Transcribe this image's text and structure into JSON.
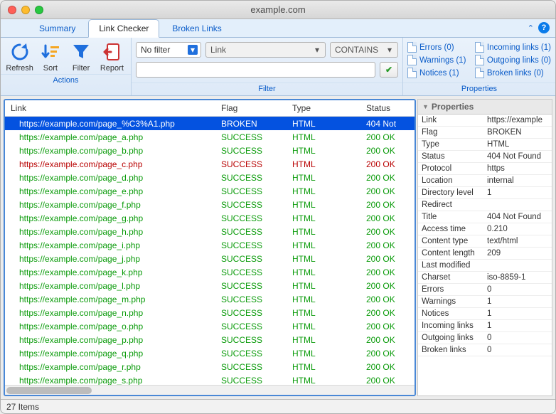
{
  "window": {
    "title": "example.com"
  },
  "tabs": {
    "summary": "Summary",
    "linkchecker": "Link Checker",
    "brokenlinks": "Broken Links"
  },
  "toolbar": {
    "refresh": "Refresh",
    "sort": "Sort",
    "filter": "Filter",
    "report": "Report",
    "actions_label": "Actions",
    "filter_label": "Filter",
    "properties_label": "Properties"
  },
  "filter": {
    "scope": "No filter",
    "field": "Link",
    "op": "CONTAINS",
    "value": ""
  },
  "propertyLinks": {
    "errors": "Errors (0)",
    "warnings": "Warnings (1)",
    "notices": "Notices (1)",
    "incoming": "Incoming links (1)",
    "outgoing": "Outgoing links (0)",
    "broken": "Broken links (0)"
  },
  "columns": {
    "link": "Link",
    "flag": "Flag",
    "type": "Type",
    "status": "Status"
  },
  "rows": [
    {
      "link": "https://example.com/page_%C3%A1.php",
      "flag": "BROKEN",
      "type": "HTML",
      "status": "404 Not",
      "color": "#b80000",
      "selected": true
    },
    {
      "link": "https://example.com/page_a.php",
      "flag": "SUCCESS",
      "type": "HTML",
      "status": "200 OK",
      "color": "#0a9b0a"
    },
    {
      "link": "https://example.com/page_b.php",
      "flag": "SUCCESS",
      "type": "HTML",
      "status": "200 OK",
      "color": "#0a9b0a"
    },
    {
      "link": "https://example.com/page_c.php",
      "flag": "SUCCESS",
      "type": "HTML",
      "status": "200 OK",
      "color": "#b80000"
    },
    {
      "link": "https://example.com/page_d.php",
      "flag": "SUCCESS",
      "type": "HTML",
      "status": "200 OK",
      "color": "#0a9b0a"
    },
    {
      "link": "https://example.com/page_e.php",
      "flag": "SUCCESS",
      "type": "HTML",
      "status": "200 OK",
      "color": "#0a9b0a"
    },
    {
      "link": "https://example.com/page_f.php",
      "flag": "SUCCESS",
      "type": "HTML",
      "status": "200 OK",
      "color": "#0a9b0a"
    },
    {
      "link": "https://example.com/page_g.php",
      "flag": "SUCCESS",
      "type": "HTML",
      "status": "200 OK",
      "color": "#0a9b0a"
    },
    {
      "link": "https://example.com/page_h.php",
      "flag": "SUCCESS",
      "type": "HTML",
      "status": "200 OK",
      "color": "#0a9b0a"
    },
    {
      "link": "https://example.com/page_i.php",
      "flag": "SUCCESS",
      "type": "HTML",
      "status": "200 OK",
      "color": "#0a9b0a"
    },
    {
      "link": "https://example.com/page_j.php",
      "flag": "SUCCESS",
      "type": "HTML",
      "status": "200 OK",
      "color": "#0a9b0a"
    },
    {
      "link": "https://example.com/page_k.php",
      "flag": "SUCCESS",
      "type": "HTML",
      "status": "200 OK",
      "color": "#0a9b0a"
    },
    {
      "link": "https://example.com/page_l.php",
      "flag": "SUCCESS",
      "type": "HTML",
      "status": "200 OK",
      "color": "#0a9b0a"
    },
    {
      "link": "https://example.com/page_m.php",
      "flag": "SUCCESS",
      "type": "HTML",
      "status": "200 OK",
      "color": "#0a9b0a"
    },
    {
      "link": "https://example.com/page_n.php",
      "flag": "SUCCESS",
      "type": "HTML",
      "status": "200 OK",
      "color": "#0a9b0a"
    },
    {
      "link": "https://example.com/page_o.php",
      "flag": "SUCCESS",
      "type": "HTML",
      "status": "200 OK",
      "color": "#0a9b0a"
    },
    {
      "link": "https://example.com/page_p.php",
      "flag": "SUCCESS",
      "type": "HTML",
      "status": "200 OK",
      "color": "#0a9b0a"
    },
    {
      "link": "https://example.com/page_q.php",
      "flag": "SUCCESS",
      "type": "HTML",
      "status": "200 OK",
      "color": "#0a9b0a"
    },
    {
      "link": "https://example.com/page_r.php",
      "flag": "SUCCESS",
      "type": "HTML",
      "status": "200 OK",
      "color": "#0a9b0a"
    },
    {
      "link": "https://example.com/page_s.php",
      "flag": "SUCCESS",
      "type": "HTML",
      "status": "200 OK",
      "color": "#0a9b0a"
    }
  ],
  "propPanel": {
    "heading": "Properties",
    "items": [
      {
        "k": "Link",
        "v": "https://example"
      },
      {
        "k": "Flag",
        "v": "BROKEN"
      },
      {
        "k": "Type",
        "v": "HTML"
      },
      {
        "k": "Status",
        "v": "404 Not Found"
      },
      {
        "k": "Protocol",
        "v": "https"
      },
      {
        "k": "Location",
        "v": "internal"
      },
      {
        "k": "Directory level",
        "v": "1"
      },
      {
        "k": "Redirect",
        "v": ""
      },
      {
        "k": "Title",
        "v": "404 Not Found"
      },
      {
        "k": "Access time",
        "v": "0.210"
      },
      {
        "k": "Content type",
        "v": "text/html"
      },
      {
        "k": "Content length",
        "v": "209"
      },
      {
        "k": "Last modified",
        "v": ""
      },
      {
        "k": "Charset",
        "v": "iso-8859-1"
      },
      {
        "k": "Errors",
        "v": "0"
      },
      {
        "k": "Warnings",
        "v": "1"
      },
      {
        "k": "Notices",
        "v": "1"
      },
      {
        "k": "Incoming links",
        "v": "1"
      },
      {
        "k": "Outgoing links",
        "v": "0"
      },
      {
        "k": "Broken links",
        "v": "0"
      }
    ]
  },
  "status": {
    "items": "27 Items"
  }
}
